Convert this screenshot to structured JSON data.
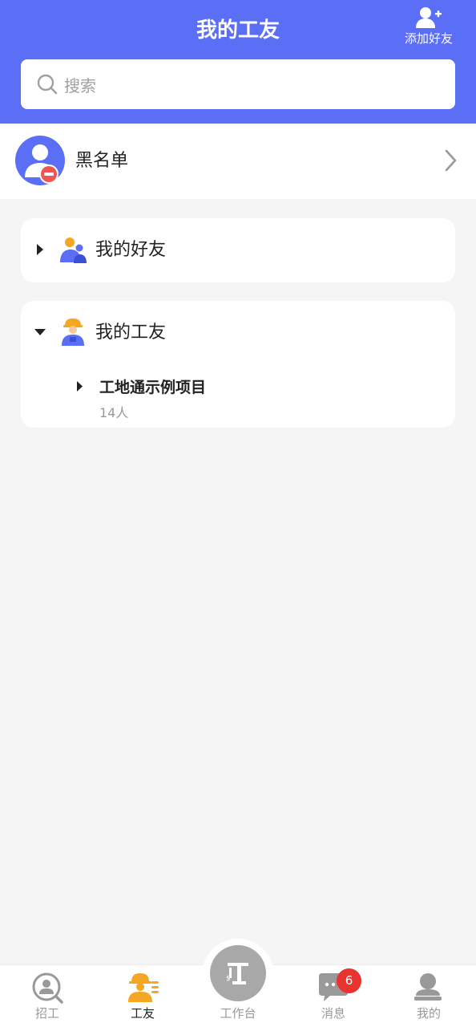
{
  "header": {
    "title": "我的工友",
    "add_friend_label": "添加好友"
  },
  "search": {
    "placeholder": "搜索"
  },
  "blacklist": {
    "label": "黑名单"
  },
  "groups": [
    {
      "label": "我的好友",
      "expanded": false,
      "icon": "friends-icon"
    },
    {
      "label": "我的工友",
      "expanded": true,
      "icon": "worker-icon",
      "subgroups": [
        {
          "label": "工地通示例项目",
          "count": "14人",
          "expanded": false
        }
      ]
    }
  ],
  "tabbar": {
    "tabs": [
      {
        "label": "招工",
        "icon": "recruit-icon",
        "active": false
      },
      {
        "label": "工友",
        "icon": "workmates-icon",
        "active": true
      },
      {
        "label": "工作台",
        "icon": "workbench-icon",
        "active": false
      },
      {
        "label": "消息",
        "icon": "message-icon",
        "active": false,
        "badge": "6"
      },
      {
        "label": "我的",
        "icon": "profile-icon",
        "active": false
      }
    ]
  },
  "colors": {
    "primary": "#5b6ef6",
    "accent_orange": "#f5a623",
    "badge_red": "#e8332f",
    "remove_red": "#f05454"
  }
}
